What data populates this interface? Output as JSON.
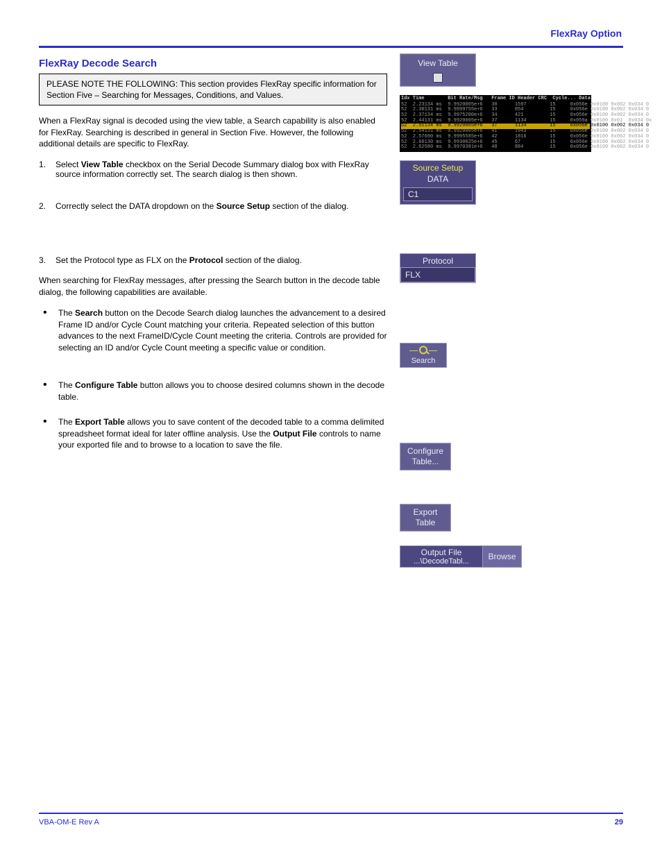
{
  "header": {
    "caption": "FlexRay Option"
  },
  "section": {
    "title": "FlexRay Decode Search",
    "callout": "PLEASE NOTE THE FOLLOWING: This section provides FlexRay specific information for Section Five – Searching for Messages, Conditions, and Values.",
    "intro_para": "When a FlexRay signal is decoded using the view table, a Search capability is also enabled for FlexRay. Searching is described in general in Section Five. However, the following additional details are specific to FlexRay.",
    "step1_num": "1.",
    "step1_a": "Select ",
    "step1_b": "View Table",
    "step1_c": " checkbox on the Serial Decode Summary dialog box with FlexRay source information correctly set. The search dialog is then shown.",
    "step2_num": "2.",
    "step2_a": "Correctly select the DATA dropdown on the ",
    "step2_b": "Source Setup",
    "step2_c": " section of the dialog.",
    "step3_num": "3.",
    "step3_a": "Set the Protocol type as FLX on the ",
    "step3_b": "Protocol",
    "step3_c": " section of the dialog.",
    "post_para": "When searching for FlexRay messages, after pressing the Search button in the decode table dialog, the following capabilities are available."
  },
  "bullets": {
    "b1_a": "The ",
    "b1_b": "Search",
    "b1_c": " button on the Decode Search dialog launches the advancement to a desired Frame ID and/or Cycle Count matching your criteria. Repeated selection of this button advances to the next FrameID/Cycle Count meeting the criteria. Controls are provided for selecting an ID and/or Cycle Count meeting a specific value or condition.",
    "b2_a": "The ",
    "b2_b": "Configure Table",
    "b2_c": " button allows you to choose desired columns shown in the decode table.",
    "b3_a": "The ",
    "b3_b": "Export Table",
    "b3_c": " allows you to save content of the decoded table to a comma delimited spreadsheet format ideal for later offline analysis. Use the ",
    "b3_d": "Output File",
    "b3_e": " controls to name your exported file and to browse to a location to save the file."
  },
  "ui": {
    "view_table_label": "View Table",
    "source_setup_title": "Source Setup",
    "source_setup_sub": "DATA",
    "source_setup_value": "C1",
    "protocol_label": "Protocol",
    "protocol_value": "FLX",
    "search_label": "Search",
    "configure_label_1": "Configure",
    "configure_label_2": "Table...",
    "export_label_1": "Export",
    "export_label_2": "Table",
    "output_file_label": "Output File",
    "output_file_path": "...\\DecodeTabl...",
    "browse_label": "Browse"
  },
  "table_preview": {
    "header": "Idx Time        Bit Rate/Msg   Frame ID Header CRC  Cycle... Data",
    "rows": [
      "52  2.23134 ms  9.9920005e+6   30      1597        15     0x056e 0x0100 0x002 0x034 0",
      "52  2.30131 ms  9.9899755e+6   33      854         15     0x056e 0x0100 0x002 0x034 0",
      "52  2.37134 ms  9.9975200e+6   34      421         15     0x056e 0x0100 0x002 0x034 0",
      "52  2.44131 ms  9.9920005e+6   37      1134        15     0x059a 0x0100 0x01  0x034 0x",
      "52  2.51134 ms  9.9920005e+6   37      1134        15     0x056e 0x0100 0x002 0x034 0",
      "52  2.54131 ms  9.9920005e+6   41      1943        15     0x056e 0x0100 0x002 0x034 0",
      "52  2.57690 ms  9.9995585e+6   42      1816        15     0x056e 0x0100 0x002 0x034 0",
      "52  2.60130 ms  9.9930025e+6   45      67          15     0x056e 0x0100 0x002 0x034 0",
      "52  2.62580 ms  9.9970381e+6   48      884         15     0x056e 0x0100 0x002 0x034 0"
    ],
    "highlight_index": 4
  },
  "footer": {
    "left": "VBA-OM-E Rev A",
    "right": "29"
  }
}
